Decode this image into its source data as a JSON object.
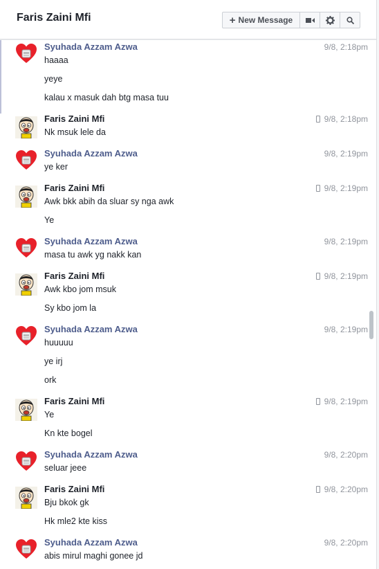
{
  "header": {
    "title": "Faris Zaini Mfi",
    "new_message_label": "New Message",
    "buttons": [
      "plus-icon",
      "video-icon",
      "gear-icon",
      "search-icon"
    ]
  },
  "colors": {
    "sender_syuhada": "#4e5d8c",
    "sender_faris": "#1d2129",
    "timestamp": "#90949c",
    "heart": "#e8212a"
  },
  "messages": [
    {
      "sender": "Syuhada Azzam Azwa",
      "who": "s",
      "time": "9/8, 2:18pm",
      "mobile": false,
      "lines": [
        "haaaa",
        "yeye",
        "kalau x masuk dah btg masa tuu"
      ]
    },
    {
      "sender": "Faris Zaini Mfi",
      "who": "f",
      "time": "9/8, 2:18pm",
      "mobile": true,
      "lines": [
        "Nk msuk lele da"
      ]
    },
    {
      "sender": "Syuhada Azzam Azwa",
      "who": "s",
      "time": "9/8, 2:19pm",
      "mobile": false,
      "lines": [
        "ye ker"
      ]
    },
    {
      "sender": "Faris Zaini Mfi",
      "who": "f",
      "time": "9/8, 2:19pm",
      "mobile": true,
      "lines": [
        "Awk bkk abih da sluar sy nga awk",
        "Ye"
      ]
    },
    {
      "sender": "Syuhada Azzam Azwa",
      "who": "s",
      "time": "9/8, 2:19pm",
      "mobile": false,
      "lines": [
        "masa tu awk yg nakk kan"
      ]
    },
    {
      "sender": "Faris Zaini Mfi",
      "who": "f",
      "time": "9/8, 2:19pm",
      "mobile": true,
      "lines": [
        "Awk kbo jom msuk",
        "Sy kbo jom la"
      ]
    },
    {
      "sender": "Syuhada Azzam Azwa",
      "who": "s",
      "time": "9/8, 2:19pm",
      "mobile": false,
      "lines": [
        "huuuuu",
        "ye irj",
        "ork"
      ]
    },
    {
      "sender": "Faris Zaini Mfi",
      "who": "f",
      "time": "9/8, 2:19pm",
      "mobile": true,
      "lines": [
        "Ye",
        "Kn kte bogel"
      ]
    },
    {
      "sender": "Syuhada Azzam Azwa",
      "who": "s",
      "time": "9/8, 2:20pm",
      "mobile": false,
      "lines": [
        "seluar jeee"
      ]
    },
    {
      "sender": "Faris Zaini Mfi",
      "who": "f",
      "time": "9/8, 2:20pm",
      "mobile": true,
      "lines": [
        "Bju bkok gk",
        "Hk mle2 kte kiss"
      ]
    },
    {
      "sender": "Syuhada Azzam Azwa",
      "who": "s",
      "time": "9/8, 2:20pm",
      "mobile": false,
      "lines": [
        "abis mirul maghi gonee jd"
      ]
    }
  ]
}
